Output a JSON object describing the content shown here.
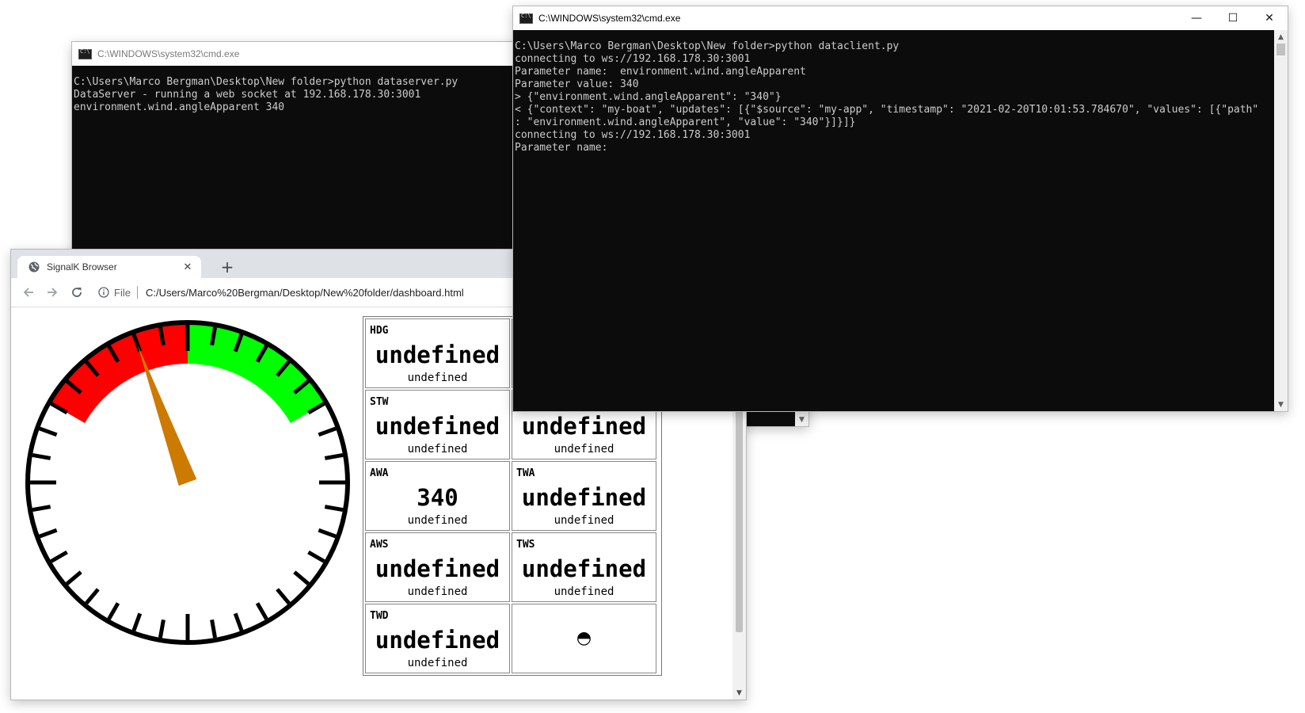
{
  "server_window": {
    "title": "C:\\WINDOWS\\system32\\cmd.exe",
    "lines": [
      "C:\\Users\\Marco Bergman\\Desktop\\New folder>python dataserver.py",
      "DataServer - running a web socket at 192.168.178.30:3001",
      "environment.wind.angleApparent 340"
    ]
  },
  "client_window": {
    "title": "C:\\WINDOWS\\system32\\cmd.exe",
    "controls": {
      "minimize": "—",
      "maximize": "☐",
      "close": "✕"
    },
    "lines": [
      "C:\\Users\\Marco Bergman\\Desktop\\New folder>python dataclient.py",
      "connecting to ws://192.168.178.30:3001",
      "Parameter name:  environment.wind.angleApparent",
      "Parameter value: 340",
      "> {\"environment.wind.angleApparent\": \"340\"}",
      "< {\"context\": \"my-boat\", \"updates\": [{\"$source\": \"my-app\", \"timestamp\": \"2021-02-20T10:01:53.784670\", \"values\": [{\"path\"",
      ": \"environment.wind.angleApparent\", \"value\": \"340\"}]}]}",
      "connecting to ws://192.168.178.30:3001",
      "Parameter name:"
    ]
  },
  "browser": {
    "tab_title": "SignalK Browser",
    "tab_close": "✕",
    "new_tab": "+",
    "omnibox": {
      "scheme_label": "File",
      "url": "C:/Users/Marco%20Bergman/Desktop/New%20folder/dashboard.html"
    },
    "gauge": {
      "value_deg": 340,
      "red_range": [
        300,
        360
      ],
      "green_range": [
        0,
        60
      ],
      "colors": {
        "red": "#ff0000",
        "green": "#00ff00",
        "needle": "#cc7a00"
      }
    },
    "cells": [
      {
        "label": "HDG",
        "value": "undefined",
        "sub": "undefined"
      },
      {
        "label": "",
        "value": "",
        "sub": ""
      },
      {
        "label": "STW",
        "value": "undefined",
        "sub": "undefined"
      },
      {
        "label": "",
        "value": "undefined",
        "sub": "undefined"
      },
      {
        "label": "AWA",
        "value": "340",
        "sub": "undefined"
      },
      {
        "label": "TWA",
        "value": "undefined",
        "sub": "undefined"
      },
      {
        "label": "AWS",
        "value": "undefined",
        "sub": "undefined"
      },
      {
        "label": "TWS",
        "value": "undefined",
        "sub": "undefined"
      },
      {
        "label": "TWD",
        "value": "undefined",
        "sub": "undefined"
      }
    ],
    "status_glyph": "◓"
  }
}
